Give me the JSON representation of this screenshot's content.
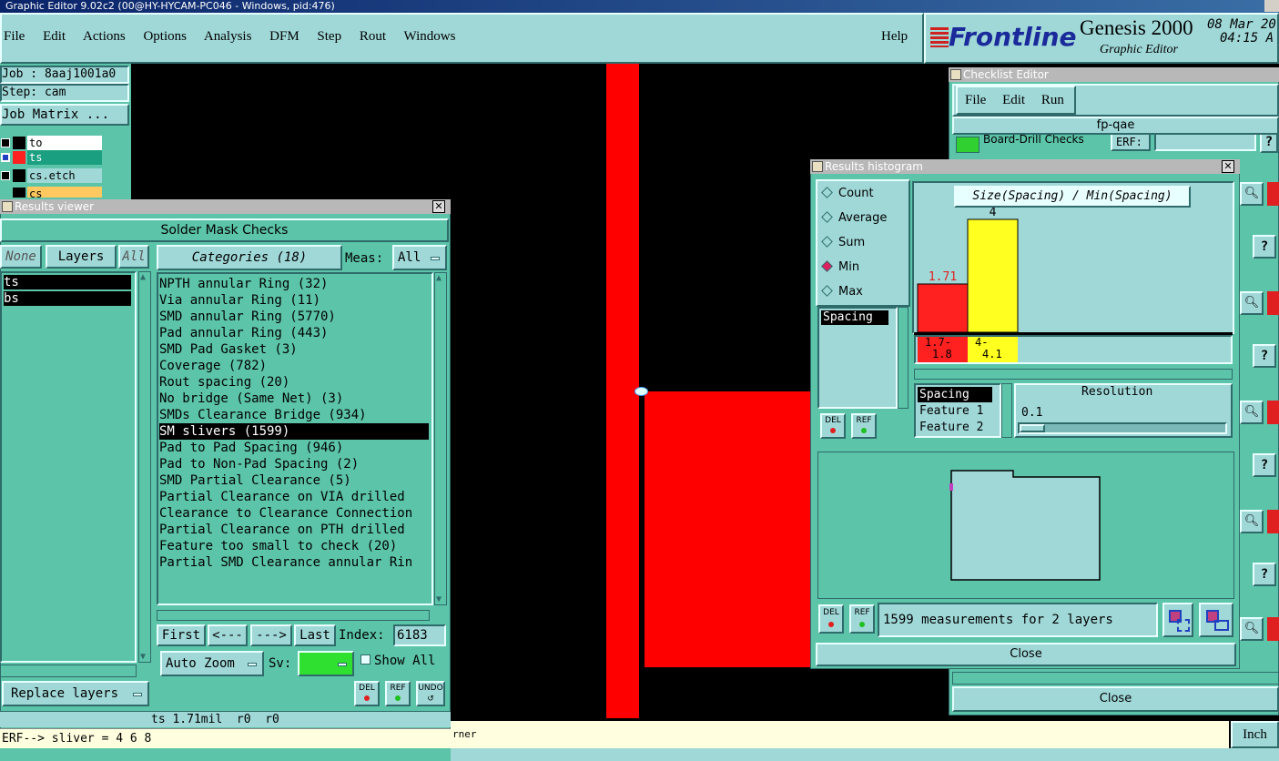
{
  "window_title": "Graphic Editor 9.02c2 (00@HY-HYCAM-PC046 - Windows, pid:476)",
  "menu": [
    "File",
    "Edit",
    "Actions",
    "Options",
    "Analysis",
    "DFM",
    "Step",
    "Rout",
    "Windows"
  ],
  "help": "Help",
  "brand": {
    "logo": "Frontline",
    "product": "Genesis 2000",
    "subtitle": "Graphic Editor",
    "date": "08 Mar 20",
    "time": "04:15 A"
  },
  "job": {
    "job_line": "Job : 8aaj1001a0",
    "step_line": "Step: cam",
    "job_matrix": "Job Matrix ..."
  },
  "layers_panel": [
    {
      "name": "to",
      "color": "#000000"
    },
    {
      "name": "ts",
      "color": "#ff2020"
    },
    {
      "name": "cs.etch",
      "color": "#000000"
    },
    {
      "name": "cs",
      "color": "#000000"
    }
  ],
  "results_viewer": {
    "title": "Results viewer",
    "heading": "Solder Mask Checks",
    "btn_none": "None",
    "btn_layers": "Layers",
    "btn_all": "All",
    "categories_label": "Categories (18)",
    "meas_label": "Meas:",
    "meas_value": "All",
    "layers": [
      "ts",
      "bs"
    ],
    "categories": [
      "NPTH annular Ring (32)",
      "Via annular Ring (11)",
      "SMD annular Ring (5770)",
      "Pad annular Ring (443)",
      "SMD Pad Gasket (3)",
      "Coverage (782)",
      "Rout spacing (20)",
      "No bridge (Same Net) (3)",
      "SMDs Clearance Bridge (934)",
      "SM slivers (1599)",
      "Pad to Pad Spacing (946)",
      "Pad to Non-Pad Spacing (2)",
      "SMD Partial Clearance (5)",
      "Partial Clearance on VIA drilled",
      "Clearance to Clearance Connection",
      "Partial Clearance on PTH drilled",
      "Feature too small to check (20)",
      "Partial SMD Clearance annular Rin"
    ],
    "selected_index": 9,
    "nav": {
      "first": "First",
      "prev": "<---",
      "next": "--->",
      "last": "Last",
      "index_label": "Index:",
      "index_value": "6183"
    },
    "auto_zoom": "Auto Zoom",
    "sv_label": "Sv:",
    "show_all": "Show All",
    "replace_layers": "Replace layers",
    "del": "DEL",
    "ref": "REF",
    "undo": "UNDO",
    "status": "ts 1.71mil  r0  r0",
    "erf_line": "ERF--> sliver = 4 6 8"
  },
  "bottom_text": "rner",
  "units": "Inch",
  "checklist": {
    "title": "Checklist Editor",
    "menu": [
      "File",
      "Edit",
      "Run"
    ],
    "name": "fp-qae",
    "row1": "Board-Drill Checks",
    "erf_label": "ERF:",
    "close": "Close"
  },
  "histogram": {
    "title": "Results histogram",
    "modes": [
      "Count",
      "Average",
      "Sum",
      "Min",
      "Max"
    ],
    "selected_mode": "Min",
    "list_items": [
      "Spacing"
    ],
    "chart_title": "Size(Spacing) / Min(Spacing)",
    "bar_value_labels": [
      "1.71",
      "4"
    ],
    "bin_labels": [
      [
        "1.7-",
        "1.8"
      ],
      [
        "4-",
        "4.1"
      ]
    ],
    "feature_list": [
      "Spacing",
      "Feature 1",
      "Feature 2"
    ],
    "resolution_label": "Resolution",
    "resolution_value": "0.1",
    "del": "DEL",
    "ref": "REF",
    "measurements": "1599 measurements for 2 layers",
    "close": "Close"
  },
  "chart_data": {
    "type": "bar",
    "title": "Size(Spacing) / Min(Spacing)",
    "categories": [
      "1.7-1.8",
      "4-4.1"
    ],
    "values": [
      1.71,
      4
    ],
    "colors": [
      "#ff2020",
      "#ffff20"
    ]
  }
}
